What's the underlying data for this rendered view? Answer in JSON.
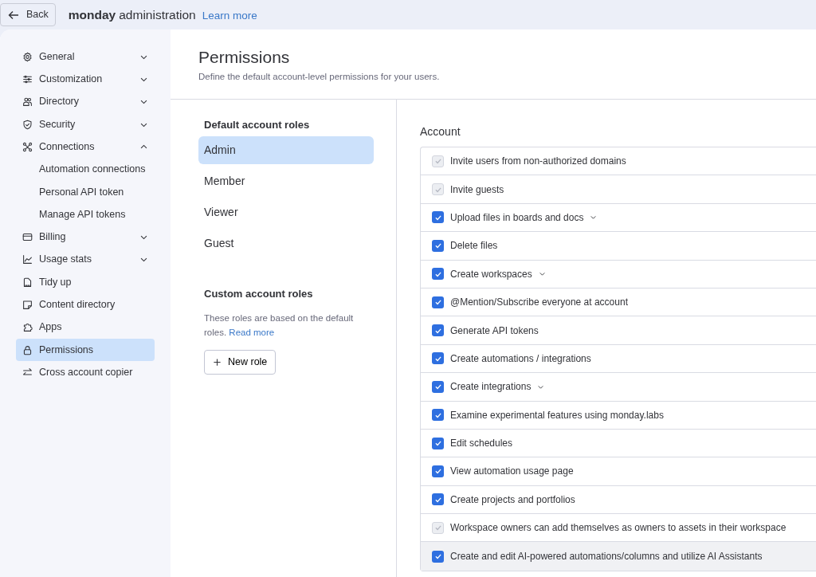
{
  "topbar": {
    "back": "Back",
    "brand": "monday",
    "title": "administration",
    "link": "Learn more"
  },
  "sidebar": {
    "items": [
      {
        "label": "General",
        "expanded": false,
        "selected": false
      },
      {
        "label": "Customization",
        "expanded": false,
        "selected": false
      },
      {
        "label": "Directory",
        "expanded": false,
        "selected": false
      },
      {
        "label": "Security",
        "expanded": false,
        "selected": false
      },
      {
        "label": "Connections",
        "expanded": true,
        "selected": false,
        "children": [
          {
            "label": "Automation connections",
            "selected": false
          },
          {
            "label": "Personal API token",
            "selected": false
          },
          {
            "label": "Manage API tokens",
            "selected": false
          }
        ]
      },
      {
        "label": "Billing",
        "expanded": false,
        "selected": false
      },
      {
        "label": "Usage stats",
        "expanded": false,
        "selected": false
      },
      {
        "label": "Tidy up",
        "selected": false
      },
      {
        "label": "Content directory",
        "selected": false
      },
      {
        "label": "Apps",
        "selected": false
      },
      {
        "label": "Permissions",
        "selected": true
      },
      {
        "label": "Cross account copier",
        "selected": false
      }
    ]
  },
  "page": {
    "title": "Permissions",
    "subtitle": "Define the default account-level permissions for your users."
  },
  "roles": {
    "default_title": "Default account roles",
    "default_roles": [
      {
        "label": "Admin",
        "selected": true
      },
      {
        "label": "Member",
        "selected": false
      },
      {
        "label": "Viewer",
        "selected": false
      },
      {
        "label": "Guest",
        "selected": false
      }
    ],
    "custom_title": "Custom account roles",
    "custom_text": "These roles are based on the default roles.",
    "custom_link": "Read more",
    "new_role": "New role"
  },
  "permissions": {
    "title": "Account",
    "items": [
      {
        "label": "Invite users from non-authorized domains",
        "checked": true,
        "disabled": true,
        "expandable": false,
        "highlighted": false
      },
      {
        "label": "Invite guests",
        "checked": true,
        "disabled": true,
        "expandable": false,
        "highlighted": false
      },
      {
        "label": "Upload files in boards and docs",
        "checked": true,
        "disabled": false,
        "expandable": true,
        "highlighted": false
      },
      {
        "label": "Delete files",
        "checked": true,
        "disabled": false,
        "expandable": false,
        "highlighted": false
      },
      {
        "label": "Create workspaces",
        "checked": true,
        "disabled": false,
        "expandable": true,
        "highlighted": false
      },
      {
        "label": "@Mention/Subscribe everyone at account",
        "checked": true,
        "disabled": false,
        "expandable": false,
        "highlighted": false
      },
      {
        "label": "Generate API tokens",
        "checked": true,
        "disabled": false,
        "expandable": false,
        "highlighted": false
      },
      {
        "label": "Create automations / integrations",
        "checked": true,
        "disabled": false,
        "expandable": false,
        "highlighted": false
      },
      {
        "label": "Create integrations",
        "checked": true,
        "disabled": false,
        "expandable": true,
        "highlighted": false
      },
      {
        "label": "Examine experimental features using monday.labs",
        "checked": true,
        "disabled": false,
        "expandable": false,
        "highlighted": false
      },
      {
        "label": "Edit schedules",
        "checked": true,
        "disabled": false,
        "expandable": false,
        "highlighted": false
      },
      {
        "label": "View automation usage page",
        "checked": true,
        "disabled": false,
        "expandable": false,
        "highlighted": false
      },
      {
        "label": "Create projects and portfolios",
        "checked": true,
        "disabled": false,
        "expandable": false,
        "highlighted": false
      },
      {
        "label": "Workspace owners can add themselves as owners to assets in their workspace",
        "checked": true,
        "disabled": true,
        "expandable": false,
        "highlighted": false
      },
      {
        "label": "Create and edit AI-powered automations/columns and utilize AI Assistants",
        "checked": true,
        "disabled": false,
        "expandable": false,
        "highlighted": true
      }
    ]
  }
}
